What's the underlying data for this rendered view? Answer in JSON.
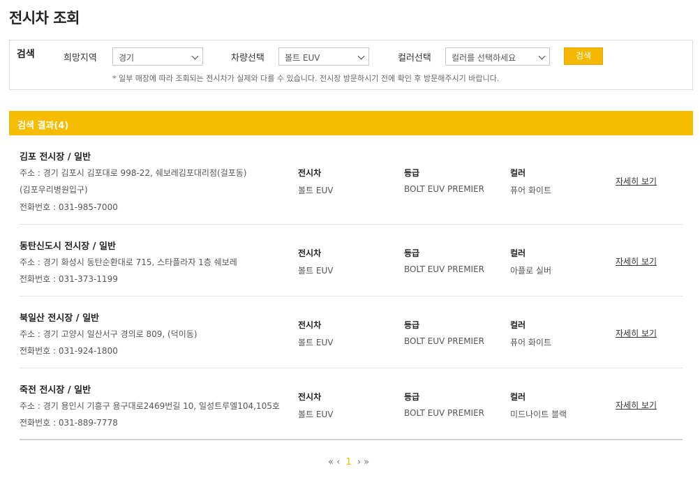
{
  "page": {
    "title": "전시차 조회"
  },
  "search": {
    "label": "검색",
    "region_label": "희망지역",
    "region_value": "경기",
    "car_label": "차량선택",
    "car_value": "볼트 EUV",
    "color_label": "컬러선택",
    "color_placeholder": "컬러를 선택하세요",
    "button_label": "검색",
    "notice": "* 일부 매장에 따라 조회되는 전시차가 실제와 다를 수 있습니다. 전시장 방문하시기 전에 확인 후 방문해주시기 바랍니다."
  },
  "results": {
    "header": "검색 결과(4)",
    "col_car": "전시차",
    "col_grade": "등급",
    "col_color": "컬러",
    "detail_label": "자세히 보기",
    "items": [
      {
        "name": "김포 전시장 / 일반",
        "address_line1": "주소 : 경기 김포시 김포대로 998-22, 쉐보레김포대리점(걸포동)",
        "address_line2": "(김포우리병원입구)",
        "phone": "전화번호 : 031-985-7000",
        "car": "볼트 EUV",
        "grade": "BOLT EUV PREMIER",
        "color": "퓨어 화이트"
      },
      {
        "name": "동탄신도시 전시장 / 일반",
        "address_line1": "주소 : 경기 화성시 동탄순환대로 715, 스타플라자 1층 쉐보레",
        "phone": "전화번호 : 031-373-1199",
        "car": "볼트 EUV",
        "grade": "BOLT EUV PREMIER",
        "color": "아플로 실버"
      },
      {
        "name": "북일산 전시장 / 일반",
        "address_line1": "주소 : 경기 고양시 일산서구 경의로 809, (덕이동)",
        "phone": "전화번호 : 031-924-1800",
        "car": "볼트 EUV",
        "grade": "BOLT EUV PREMIER",
        "color": "퓨어 화이트"
      },
      {
        "name": "죽전 전시장 / 일반",
        "address_line1": "주소 : 경기 용인시 기흥구 용구대로2469번길 10, 일성트루엘104,105호",
        "phone": "전화번호 : 031-889-7778",
        "car": "볼트 EUV",
        "grade": "BOLT EUV PREMIER",
        "color": "미드나이트 블랙"
      }
    ]
  },
  "pagination": {
    "first": "«",
    "prev": "‹",
    "current": "1",
    "next": "›",
    "last": "»"
  },
  "colors": {
    "accent": "#f5bc00",
    "border": "#dcdcdc"
  }
}
